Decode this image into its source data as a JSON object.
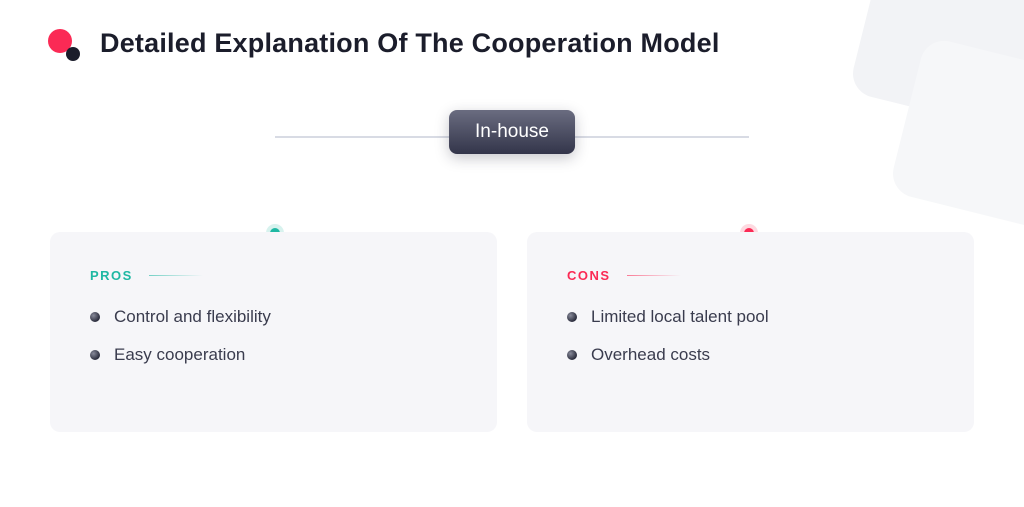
{
  "header": {
    "title": "Detailed Explanation Of The Cooperation Model"
  },
  "badge": {
    "label": "In-house"
  },
  "pros": {
    "label": "PROS",
    "items": [
      "Control and flexibility",
      "Easy cooperation"
    ]
  },
  "cons": {
    "label": "CONS",
    "items": [
      "Limited local talent pool",
      "Overhead costs"
    ]
  },
  "colors": {
    "accent_pros": "#1fb8a3",
    "accent_cons": "#fb2a55",
    "badge_grad_top": "#6a6c80",
    "badge_grad_bot": "#33354a"
  }
}
